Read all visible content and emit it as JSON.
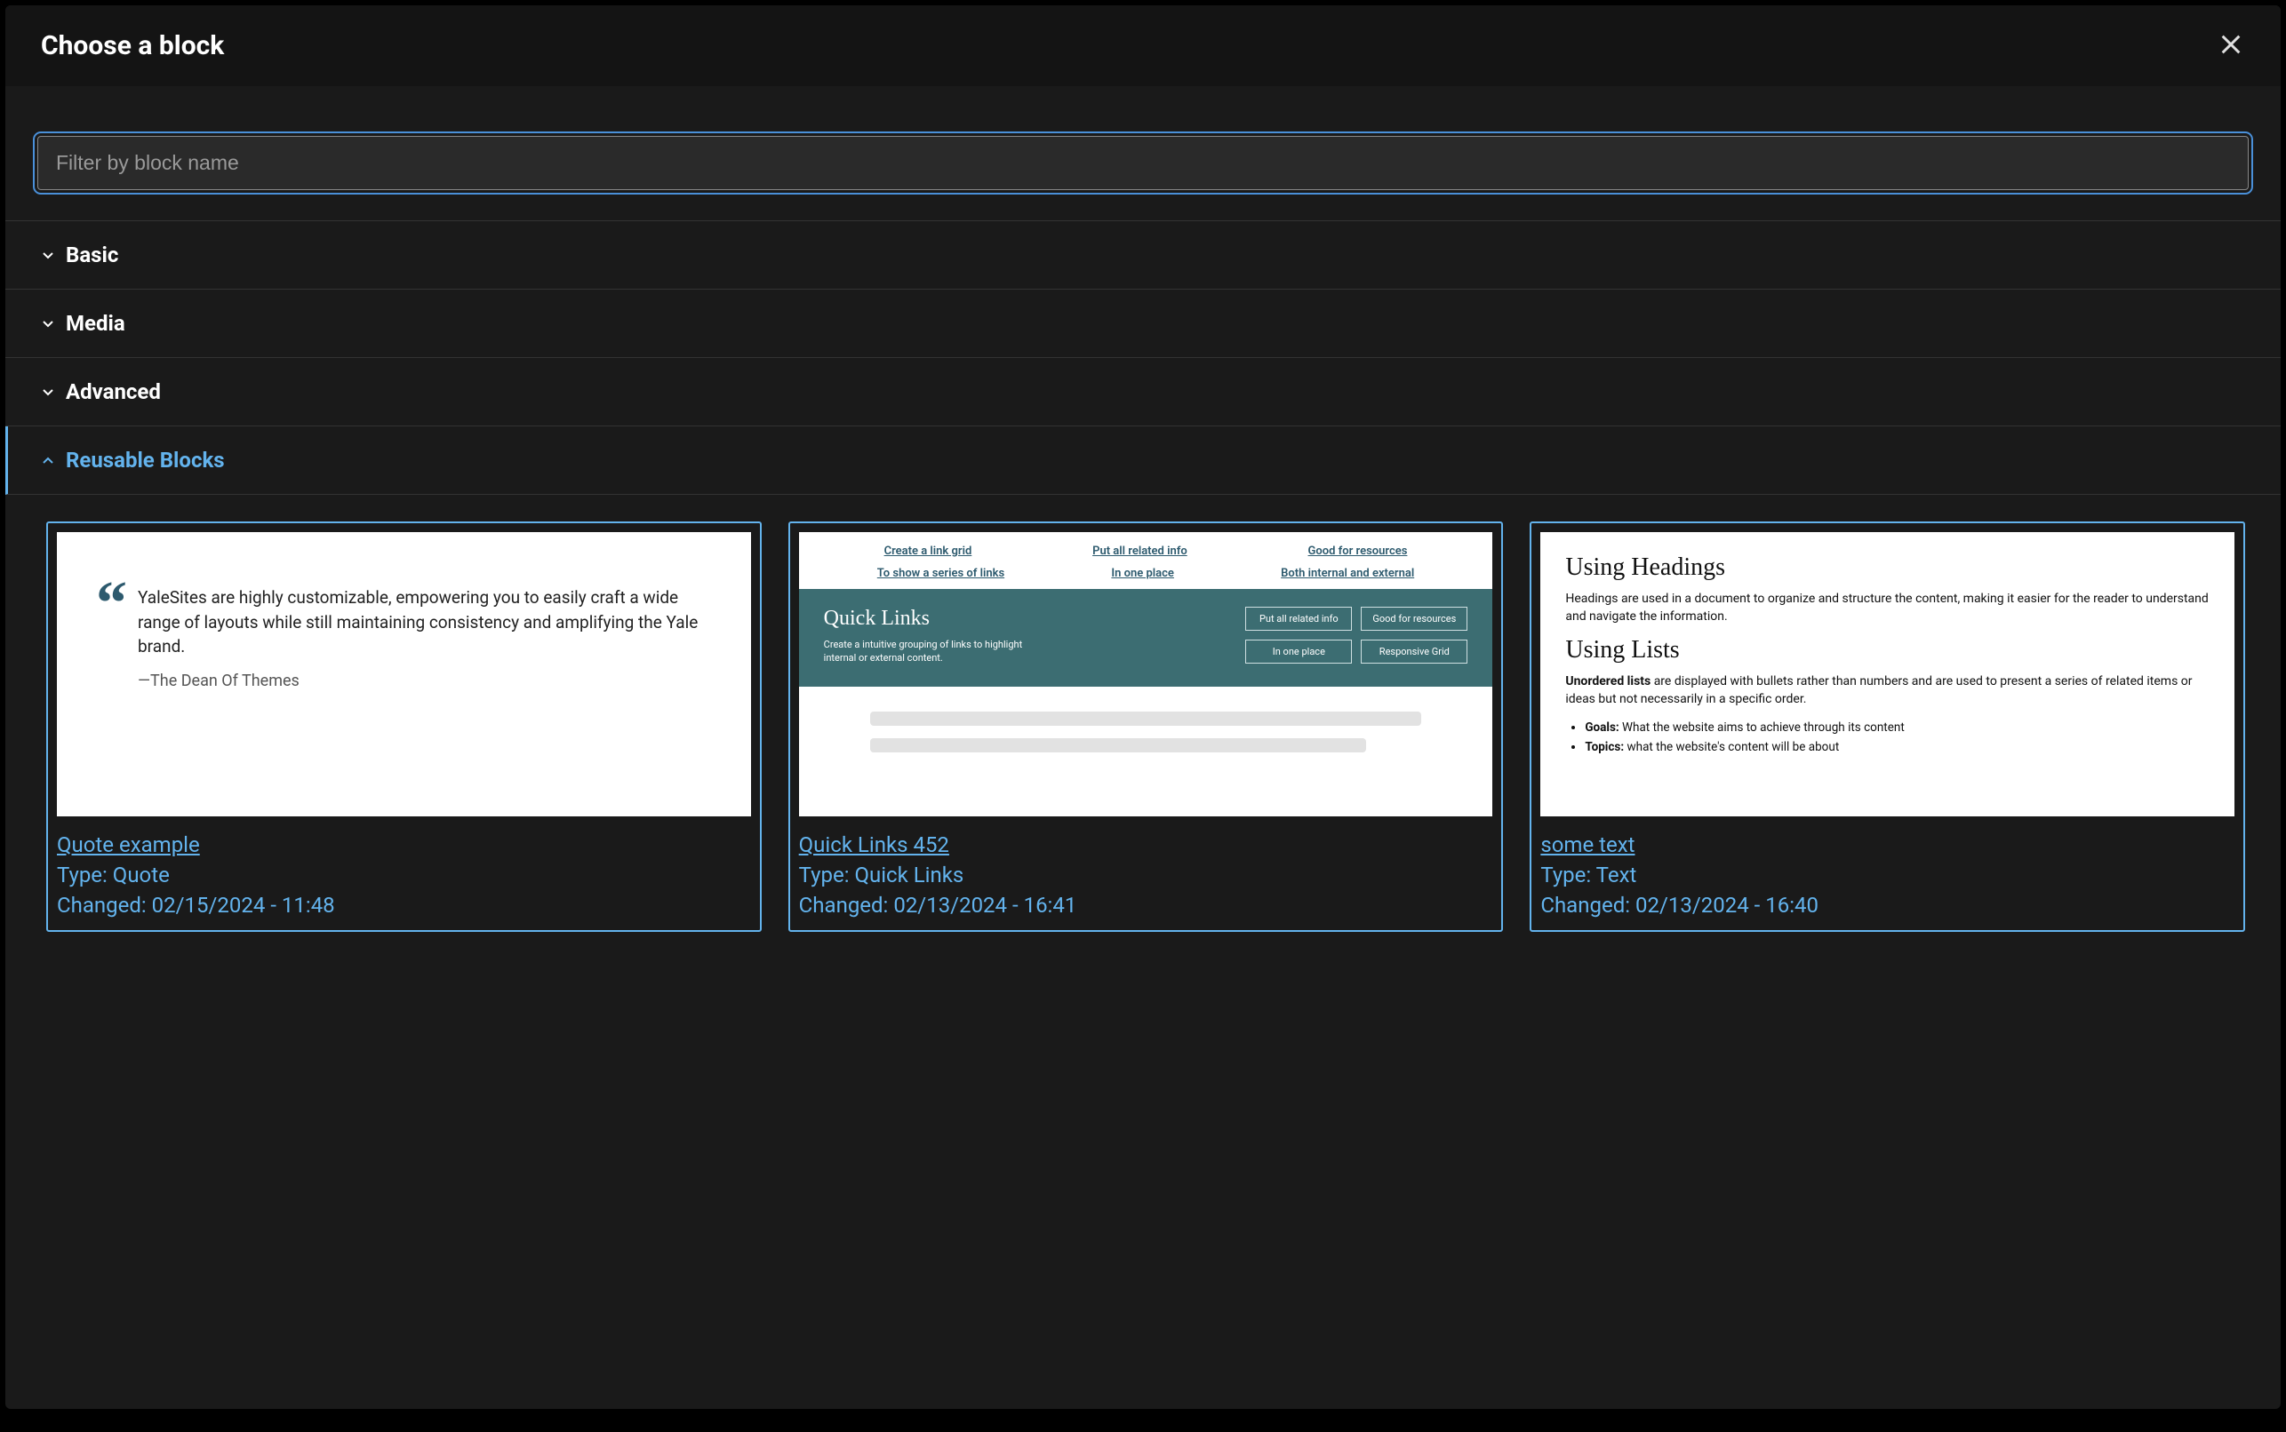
{
  "modal": {
    "title": "Choose a block"
  },
  "filter": {
    "placeholder": "Filter by block name"
  },
  "categories": {
    "basic": "Basic",
    "media": "Media",
    "advanced": "Advanced",
    "reusable": "Reusable Blocks"
  },
  "cards": [
    {
      "title": "Quote example",
      "type_line": "Type: Quote",
      "changed_line": "Changed: 02/15/2024 - 11:48",
      "preview": {
        "quote": "YaleSites are highly customizable, empowering you to easily craft a wide range of layouts while still maintaining consistency and amplifying the Yale brand.",
        "attribution": "—The Dean Of Themes"
      }
    },
    {
      "title": "Quick Links 452",
      "type_line": "Type: Quick Links",
      "changed_line": "Changed: 02/13/2024 - 16:41",
      "preview": {
        "top_links_row1": [
          "Create a link grid",
          "Put all related info",
          "Good for resources"
        ],
        "top_links_row2": [
          "To show a series of links",
          "In one place",
          "Both internal and external"
        ],
        "hero_title": "Quick Links",
        "hero_sub": "Create a intuitive grouping of links to highlight internal or external content.",
        "hero_buttons": [
          "Put all related info",
          "Good for resources",
          "In one place",
          "Responsive Grid"
        ]
      }
    },
    {
      "title": "some text",
      "type_line": "Type: Text",
      "changed_line": "Changed: 02/13/2024 - 16:40",
      "preview": {
        "h1": "Using Headings",
        "p1": "Headings are used in a document to organize and structure the content, making it easier for the reader to understand and navigate the information.",
        "h2": "Using Lists",
        "p2a": "Unordered lists",
        "p2b": " are displayed with bullets rather than numbers and are used to present a series of related items or ideas but not necessarily in a specific order.",
        "li1a": "Goals:",
        "li1b": " What the website aims to achieve through its content",
        "li2a": "Topics:",
        "li2b": " what the website's content will be about"
      }
    }
  ]
}
